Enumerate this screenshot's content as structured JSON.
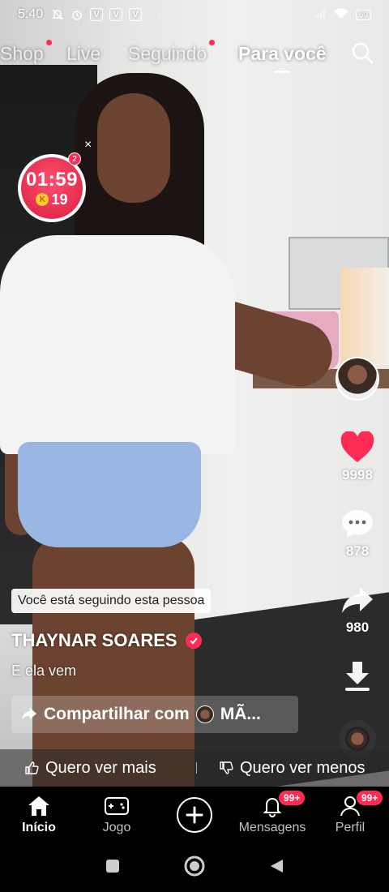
{
  "status_bar": {
    "time": "5:40",
    "battery": "60"
  },
  "top_nav": {
    "tabs": [
      {
        "label": "Shop",
        "active": false,
        "dot": true
      },
      {
        "label": "Live",
        "active": false,
        "dot": false
      },
      {
        "label": "Seguindo",
        "active": false,
        "dot": true
      },
      {
        "label": "Para você",
        "active": true,
        "dot": false
      }
    ]
  },
  "coin_timer": {
    "time": "01:59",
    "coins": "19",
    "badge": "2",
    "k_glyph": "K"
  },
  "rail": {
    "likes": "9998",
    "comments": "878",
    "shares": "980"
  },
  "post": {
    "following_tag": "Você está seguindo esta pessoa",
    "author": "THAYNAR SOARES",
    "caption": "E ela vem",
    "share_with": "Compartilhar com",
    "share_target": "MÃ..."
  },
  "feedback": {
    "more": "Quero ver mais",
    "less": "Quero ver menos"
  },
  "tabbar": {
    "home": "Início",
    "game": "Jogo",
    "messages": "Mensagens",
    "messages_badge": "99+",
    "profile": "Perfil",
    "profile_badge": "99+"
  },
  "colors": {
    "accent": "#fe2c55",
    "coin_yellow": "#ffcc2e"
  }
}
